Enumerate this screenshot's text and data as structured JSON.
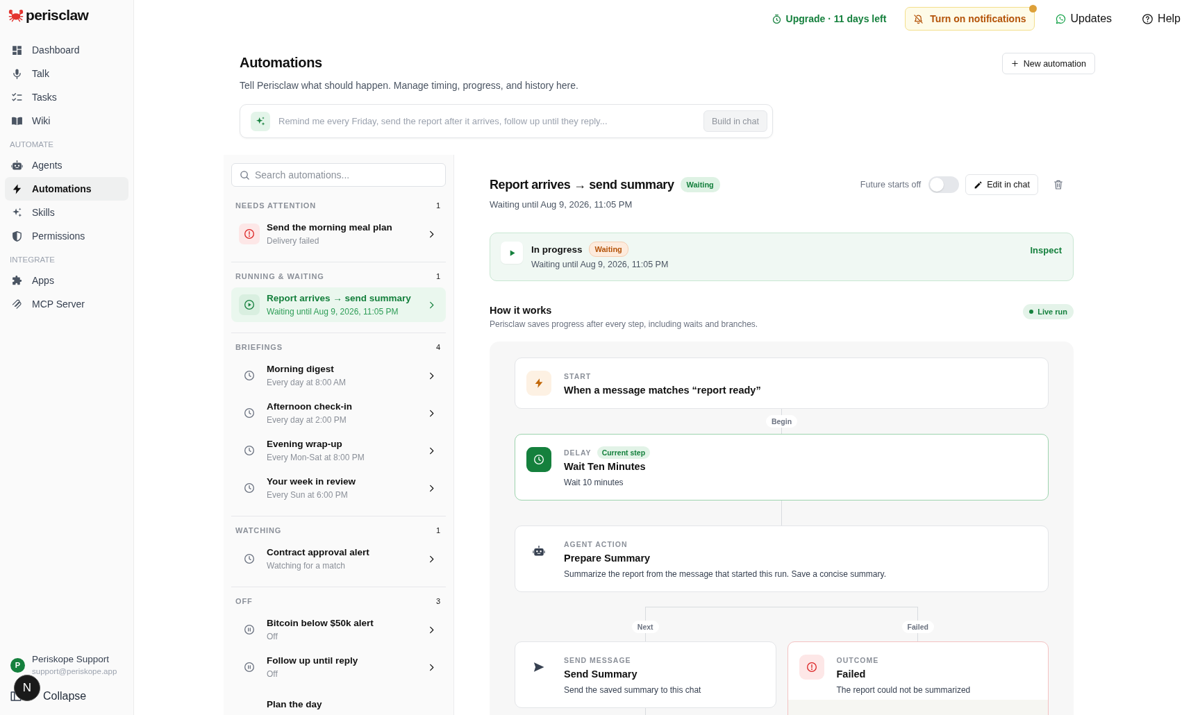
{
  "sidebar": {
    "brand": "perisclaw",
    "sections": [
      {
        "items": [
          {
            "label": "Dashboard",
            "selected": false
          },
          {
            "label": "Talk",
            "selected": false
          },
          {
            "label": "Tasks",
            "selected": false
          },
          {
            "label": "Wiki",
            "selected": false
          }
        ]
      },
      {
        "heading": "AUTOMATE",
        "items": [
          {
            "label": "Agents",
            "selected": false
          },
          {
            "label": "Automations",
            "selected": true
          },
          {
            "label": "Skills",
            "selected": false
          },
          {
            "label": "Permissions",
            "selected": false
          }
        ]
      },
      {
        "heading": "INTEGRATE",
        "items": [
          {
            "label": "Apps",
            "selected": false
          },
          {
            "label": "MCP Server",
            "selected": false
          }
        ]
      }
    ],
    "user": {
      "initial": "P",
      "name": "Periskope Support",
      "email": "support@periskope.app"
    },
    "collapse": "Collapse",
    "dev_badge": "N"
  },
  "topbar": {
    "upgrade": "Upgrade · 11 days left",
    "notifications": {
      "label": "Turn on notifications",
      "dot": true
    },
    "updates": "Updates",
    "help": "Help"
  },
  "header": {
    "title": "Automations",
    "subtitle": "Tell Perisclaw what should happen. Manage timing, progress, and history here.",
    "new_button": "New automation",
    "composer": {
      "placeholder": "Remind me every Friday, send the report after it arrives, follow up until they reply...",
      "button": {
        "label": "Build in chat",
        "disabled": true
      }
    }
  },
  "list": {
    "search_placeholder": "Search automations...",
    "groups": [
      {
        "heading": "NEEDS ATTENTION",
        "count": "1",
        "items": [
          {
            "kind": "failed",
            "title": "Send the morning meal plan",
            "subtitle": "Delivery failed",
            "selected": false
          }
        ]
      },
      {
        "heading": "RUNNING & WAITING",
        "count": "1",
        "items": [
          {
            "kind": "running",
            "title": "Report arrives → send summary",
            "subtitle": "Waiting until Aug 9, 2026, 11:05 PM",
            "selected": true
          }
        ]
      },
      {
        "heading": "BRIEFINGS",
        "count": "4",
        "items": [
          {
            "kind": "scheduled",
            "title": "Morning digest",
            "subtitle": "Every day at 8:00 AM",
            "selected": false
          },
          {
            "kind": "scheduled",
            "title": "Afternoon check-in",
            "subtitle": "Every day at 2:00 PM",
            "selected": false
          },
          {
            "kind": "scheduled",
            "title": "Evening wrap-up",
            "subtitle": "Every Mon-Sat at 8:00 PM",
            "selected": false
          },
          {
            "kind": "scheduled",
            "title": "Your week in review",
            "subtitle": "Every Sun at 6:00 PM",
            "selected": false
          }
        ]
      },
      {
        "heading": "WATCHING",
        "count": "1",
        "items": [
          {
            "kind": "watching",
            "title": "Contract approval alert",
            "subtitle": "Watching for a match",
            "selected": false
          }
        ]
      },
      {
        "heading": "OFF",
        "count": "3",
        "items": [
          {
            "kind": "off",
            "title": "Bitcoin below $50k alert",
            "subtitle": "Off",
            "selected": false
          },
          {
            "kind": "off",
            "title": "Follow up until reply",
            "subtitle": "Off",
            "selected": false
          },
          {
            "title": "Plan the day",
            "selected": false
          }
        ]
      }
    ]
  },
  "detail": {
    "title": "Report arrives → send summary",
    "badge": {
      "label": "Waiting",
      "kind": "success"
    },
    "future_starts": {
      "label": "Future starts off",
      "on": false
    },
    "edit_button": "Edit in chat",
    "subtitle": "Waiting until Aug 9, 2026, 11:05 PM",
    "run": {
      "title": "In progress",
      "badge": {
        "label": "Waiting",
        "kind": "warning"
      },
      "subtitle": "Waiting until Aug 9, 2026, 11:05 PM",
      "action": "Inspect"
    },
    "how_it_works": {
      "title": "How it works",
      "subtitle": "Perisclaw saves progress after every step, including waits and branches.",
      "badge": "Live run"
    },
    "flow": {
      "steps": [
        {
          "kind": "start",
          "label": "START",
          "title": "When a message matches “report ready”",
          "current": false
        },
        {
          "kind": "delay",
          "edge_label": "Begin",
          "label": "DELAY",
          "badge": "Current step",
          "title": "Wait Ten Minutes",
          "description": "Wait 10 minutes",
          "current": true
        },
        {
          "kind": "agent",
          "label": "AGENT ACTION",
          "title": "Prepare Summary",
          "description": "Summarize the report from the message that started this run. Save a concise summary.",
          "current": false
        }
      ],
      "branches": [
        {
          "edge_label": "Next",
          "kind": "message",
          "label": "SEND MESSAGE",
          "title": "Send Summary",
          "description": "Send the saved summary to this chat",
          "continues": true
        },
        {
          "edge_label": "Failed",
          "kind": "outcome",
          "label": "OUTCOME",
          "title": "Failed",
          "description": "The report could not be summarized",
          "continues": false
        }
      ]
    }
  }
}
